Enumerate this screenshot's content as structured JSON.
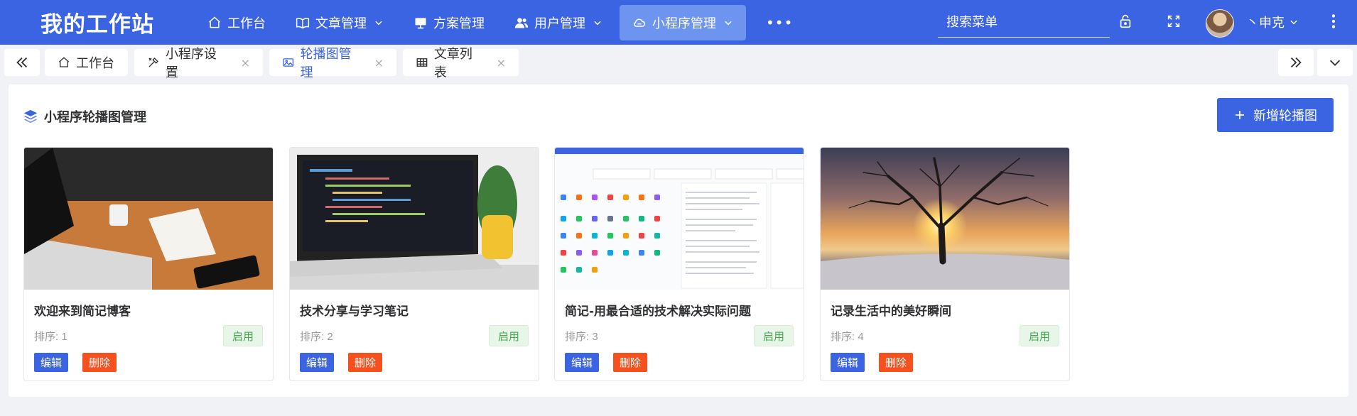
{
  "app": {
    "title": "我的工作站"
  },
  "nav": {
    "items": [
      {
        "label": "工作台",
        "icon": "home-icon",
        "has_dropdown": false
      },
      {
        "label": "文章管理",
        "icon": "book-icon",
        "has_dropdown": true
      },
      {
        "label": "方案管理",
        "icon": "presentation-icon",
        "has_dropdown": false
      },
      {
        "label": "用户管理",
        "icon": "users-icon",
        "has_dropdown": true
      },
      {
        "label": "小程序管理",
        "icon": "cloud-icon",
        "has_dropdown": true,
        "active": true
      }
    ],
    "more": "•••"
  },
  "search": {
    "placeholder": "搜索菜单"
  },
  "user": {
    "name": "丶申克"
  },
  "tabs": [
    {
      "label": "工作台",
      "icon": "home-icon",
      "closable": false
    },
    {
      "label": "小程序设置",
      "icon": "tools-icon",
      "closable": true
    },
    {
      "label": "轮播图管理",
      "icon": "image-icon",
      "closable": true,
      "active": true
    },
    {
      "label": "文章列表",
      "icon": "table-icon",
      "closable": true
    }
  ],
  "tab_close": "×",
  "page": {
    "title": "小程序轮播图管理",
    "add_button": "新增轮播图"
  },
  "cards": [
    {
      "title": "欢迎来到简记博客",
      "order": "排序: 1",
      "status": "启用",
      "edit": "编辑",
      "delete": "删除"
    },
    {
      "title": "技术分享与学习笔记",
      "order": "排序: 2",
      "status": "启用",
      "edit": "编辑",
      "delete": "删除"
    },
    {
      "title": "简记-用最合适的技术解决实际问题",
      "order": "排序: 3",
      "status": "启用",
      "edit": "编辑",
      "delete": "删除"
    },
    {
      "title": "记录生活中的美好瞬间",
      "order": "排序: 4",
      "status": "启用",
      "edit": "编辑",
      "delete": "删除"
    }
  ],
  "colors": {
    "primary": "#3b64e3",
    "active_nav": "#6d95ef",
    "danger": "#f4511e",
    "success_text": "#49a64e"
  }
}
